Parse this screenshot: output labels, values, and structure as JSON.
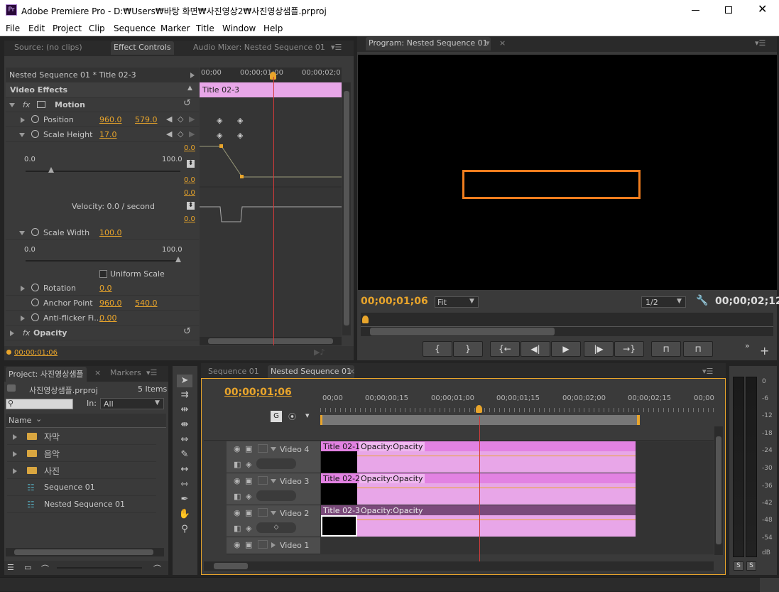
{
  "app": {
    "title": "Adobe Premiere Pro - D:₩Users₩바탕 화면₩사진영상2₩사진영상샘플.prproj",
    "logo": "Pr"
  },
  "menu": [
    "File",
    "Edit",
    "Project",
    "Clip",
    "Sequence",
    "Marker",
    "Title",
    "Window",
    "Help"
  ],
  "source_panel": {
    "tabs": [
      "Source: (no clips)",
      "Effect Controls",
      "Audio Mixer: Nested Sequence 01"
    ]
  },
  "effect_controls": {
    "header": "Nested Sequence 01 * Title 02-3",
    "ruler": [
      "00;00",
      "00;00;01;00",
      "00;00;02;0"
    ],
    "clip_bar": "Title 02-3",
    "video_effects": "Video Effects",
    "motion": "Motion",
    "position": {
      "label": "Position",
      "x": "960.0",
      "y": "579.0"
    },
    "scale_height": {
      "label": "Scale Height",
      "value": "17.0",
      "min": "0.0",
      "max": "100.0",
      "graph_top": "0.0",
      "graph_bottom": "0.0"
    },
    "velocity": {
      "label": "Velocity: 0.0 / second",
      "top": "0.0",
      "bottom": "0.0"
    },
    "scale_width": {
      "label": "Scale Width",
      "value": "100.0",
      "min": "0.0",
      "max": "100.0"
    },
    "uniform_scale": "Uniform Scale",
    "rotation": {
      "label": "Rotation",
      "value": "0.0"
    },
    "anchor_point": {
      "label": "Anchor Point",
      "x": "960.0",
      "y": "540.0"
    },
    "anti_flicker": {
      "label": "Anti-flicker Fi...",
      "value": "0.00"
    },
    "opacity": "Opacity",
    "timecode": "00;00;01;06"
  },
  "program": {
    "tab": "Program: Nested Sequence 01",
    "timecode_left": "00;00;01;06",
    "fit": "Fit",
    "resolution": "1/2",
    "timecode_right": "00;00;02;12"
  },
  "project": {
    "tabs": [
      "Project: 사진영상샘플",
      "Markers"
    ],
    "file": "사진영상샘플.prproj",
    "count": "5 Items",
    "in_label": "In:",
    "in_value": "All",
    "name_header": "Name",
    "items": [
      {
        "name": "자막",
        "type": "folder"
      },
      {
        "name": "음악",
        "type": "folder"
      },
      {
        "name": "사진",
        "type": "folder"
      },
      {
        "name": "Sequence 01",
        "type": "sequence"
      },
      {
        "name": "Nested Sequence 01",
        "type": "sequence"
      }
    ]
  },
  "timeline": {
    "tabs": [
      "Sequence 01",
      "Nested Sequence 01"
    ],
    "timecode": "00;00;01;06",
    "ruler": [
      "00;00",
      "00;00;00;15",
      "00;00;01;00",
      "00;00;01;15",
      "00;00;02;00",
      "00;00;02;15",
      "00;00"
    ],
    "tracks": [
      {
        "name": "Video 4",
        "clip": "Title 02-1",
        "fx": "Opacity:Opacity"
      },
      {
        "name": "Video 3",
        "clip": "Title 02-2",
        "fx": "Opacity:Opacity"
      },
      {
        "name": "Video 2",
        "clip": "Title 02-3",
        "fx": "Opacity:Opacity"
      },
      {
        "name": "Video 1",
        "clip": "",
        "fx": ""
      }
    ]
  },
  "meter": {
    "labels": [
      "0",
      "-6",
      "-12",
      "-18",
      "-24",
      "-30",
      "-36",
      "-42",
      "-48",
      "-54",
      "dB"
    ],
    "solo": [
      "S",
      "S"
    ]
  },
  "colors": {
    "accent": "#e9a52b",
    "clip": "#e8a6e8",
    "playhead": "#d43a3a",
    "box": "#f07d1e"
  }
}
